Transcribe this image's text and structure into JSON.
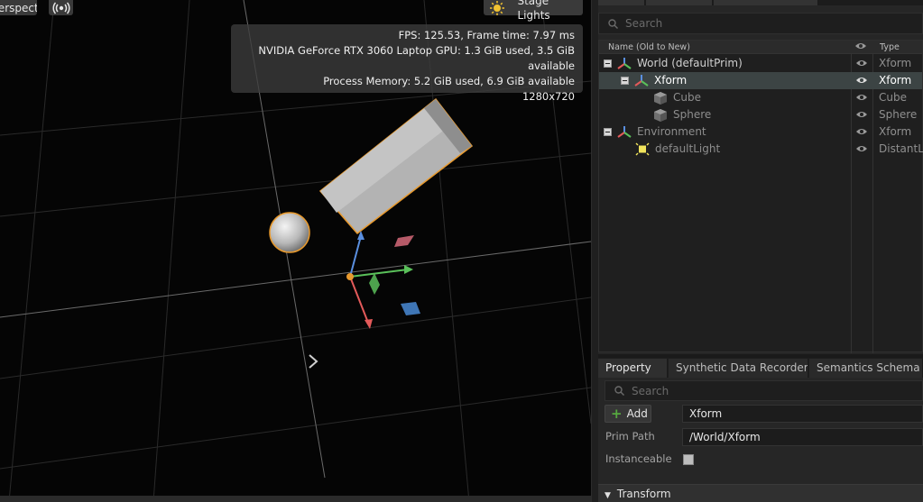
{
  "viewport": {
    "perspective_label": "Perspective",
    "stage_lights_label": "Stage Lights",
    "stats": {
      "fps_line": "FPS: 125.53, Frame time: 7.97 ms",
      "gpu_line": "NVIDIA GeForce RTX 3060 Laptop GPU: 1.3 GiB used, 3.5 GiB available",
      "memory_line": "Process Memory: 5.2 GiB used, 6.9 GiB available",
      "resolution": "1280x720"
    },
    "icons": {
      "camera": "broadcast-icon",
      "lights": "sun-icon"
    },
    "colors": {
      "selection_outline": "#e89a2e",
      "gizmo_x": "#e35a5a",
      "gizmo_y": "#5a8fe0",
      "gizmo_z": "#5ac05a"
    }
  },
  "stage": {
    "search_placeholder": "Search",
    "columns": {
      "name": "Name (Old to New)",
      "type": "Type"
    },
    "rows": [
      {
        "label": "World (defaultPrim)",
        "type": "Xform",
        "icon": "xform-icon"
      },
      {
        "label": "Xform",
        "type": "Xform",
        "icon": "xform-icon",
        "selected": true
      },
      {
        "label": "Cube",
        "type": "Cube",
        "icon": "cube-icon"
      },
      {
        "label": "Sphere",
        "type": "Sphere",
        "icon": "cube-icon"
      },
      {
        "label": "Environment",
        "type": "Xform",
        "icon": "xform-icon"
      },
      {
        "label": "defaultLight",
        "type": "DistantLig",
        "icon": "light-icon"
      }
    ]
  },
  "property": {
    "tabs": [
      "Property",
      "Synthetic Data Recorder",
      "Semantics Schema Ed"
    ],
    "search_placeholder": "Search",
    "add_label": "Add",
    "name_value": "Xform",
    "prim_path_label": "Prim Path",
    "prim_path_value": "/World/Xform",
    "instanceable_label": "Instanceable",
    "instanceable_checked": false,
    "transform_section": "Transform"
  }
}
